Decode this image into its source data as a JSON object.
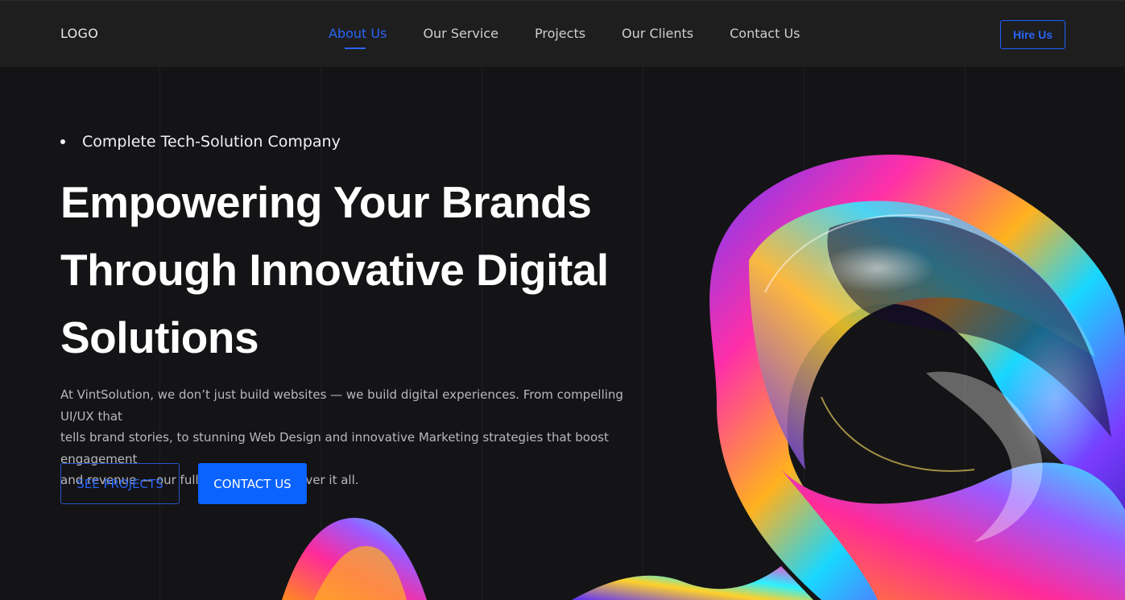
{
  "nav": {
    "logo": "LOGO",
    "links": [
      "About Us",
      "Our Service",
      "Projects",
      "Our Clients",
      "Contact Us"
    ],
    "active_index": 0,
    "cta": "Hire Us"
  },
  "hero": {
    "tagline": "Complete Tech-Solution Company",
    "headline_lines": [
      "Empowering Your Brands",
      "Through Innovative Digital",
      "Solutions"
    ],
    "description_lines": [
      "At VintSolution, we don’t just build websites — we build digital experiences. From compelling UI/UX that",
      "tells brand stories, to stunning Web Design and innovative Marketing strategies that boost engagement",
      "and revenue — our full-cycle services cover it all."
    ],
    "buttons": {
      "primary": "CONTACT US",
      "secondary": "SEE PROJECTS"
    }
  },
  "colors": {
    "accent": "#0a62ff",
    "nav_bg": "#1e1e1f",
    "page_bg": "#141416"
  }
}
